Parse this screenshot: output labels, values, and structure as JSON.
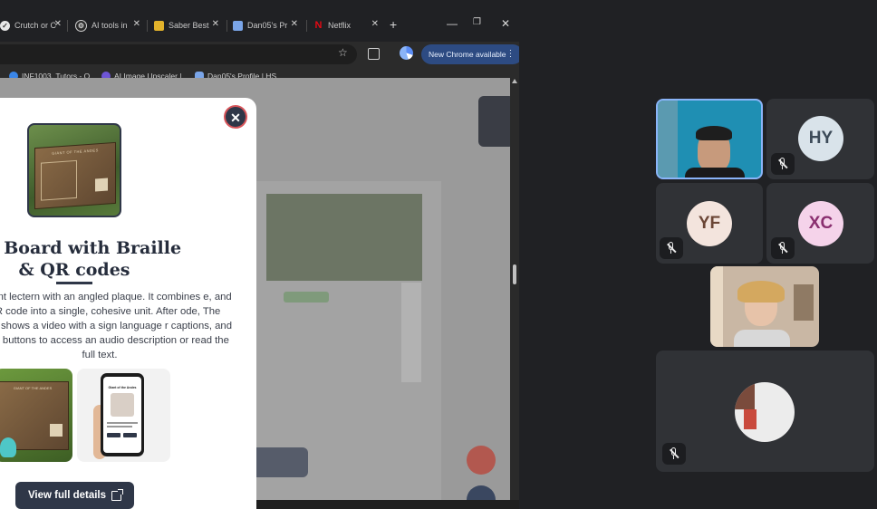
{
  "browser": {
    "tabs": [
      {
        "title": "Crutch or C",
        "icon": "crutch-favicon"
      },
      {
        "title": "AI tools in",
        "icon": "openai-favicon"
      },
      {
        "title": "Saber Best",
        "icon": "saber-favicon"
      },
      {
        "title": "Dan05's Pr",
        "icon": "huggingface-favicon"
      },
      {
        "title": "Netflix",
        "icon": "netflix-favicon"
      }
    ],
    "update_label": "New Chrome available",
    "bookmarks": [
      {
        "label": "INF1003_Tutors - O...",
        "icon": "onedrive-icon"
      },
      {
        "label": "AI Image Upscaler |...",
        "icon": "upscaler-icon"
      },
      {
        "label": "Dan05's Profile | HS...",
        "icon": "huggingface-icon"
      }
    ]
  },
  "modal": {
    "title": "ion Board with Braille & QR codes",
    "description": "resistant lectern with an angled plaque. It combines e, and a QR code into a single, cohesive unit. After ode, The screen shows a video with a sign language r captions, and simple buttons to access an audio description or read the full text.",
    "view_details_label": "View full details",
    "plaque_text": "GIANT OF THE ANDES",
    "phone_title": "Giant of the Andes"
  },
  "meeting": {
    "participants": [
      {
        "initials": "HY",
        "avatar_color": "#d9e3ea",
        "text_color": "#3c4a58",
        "muted": true
      },
      {
        "initials": "YF",
        "avatar_color": "#f3e4dd",
        "text_color": "#6b4636",
        "muted": true
      },
      {
        "initials": "XC",
        "avatar_color": "#f5d3ea",
        "text_color": "#8a2f6f",
        "muted": true
      }
    ]
  }
}
